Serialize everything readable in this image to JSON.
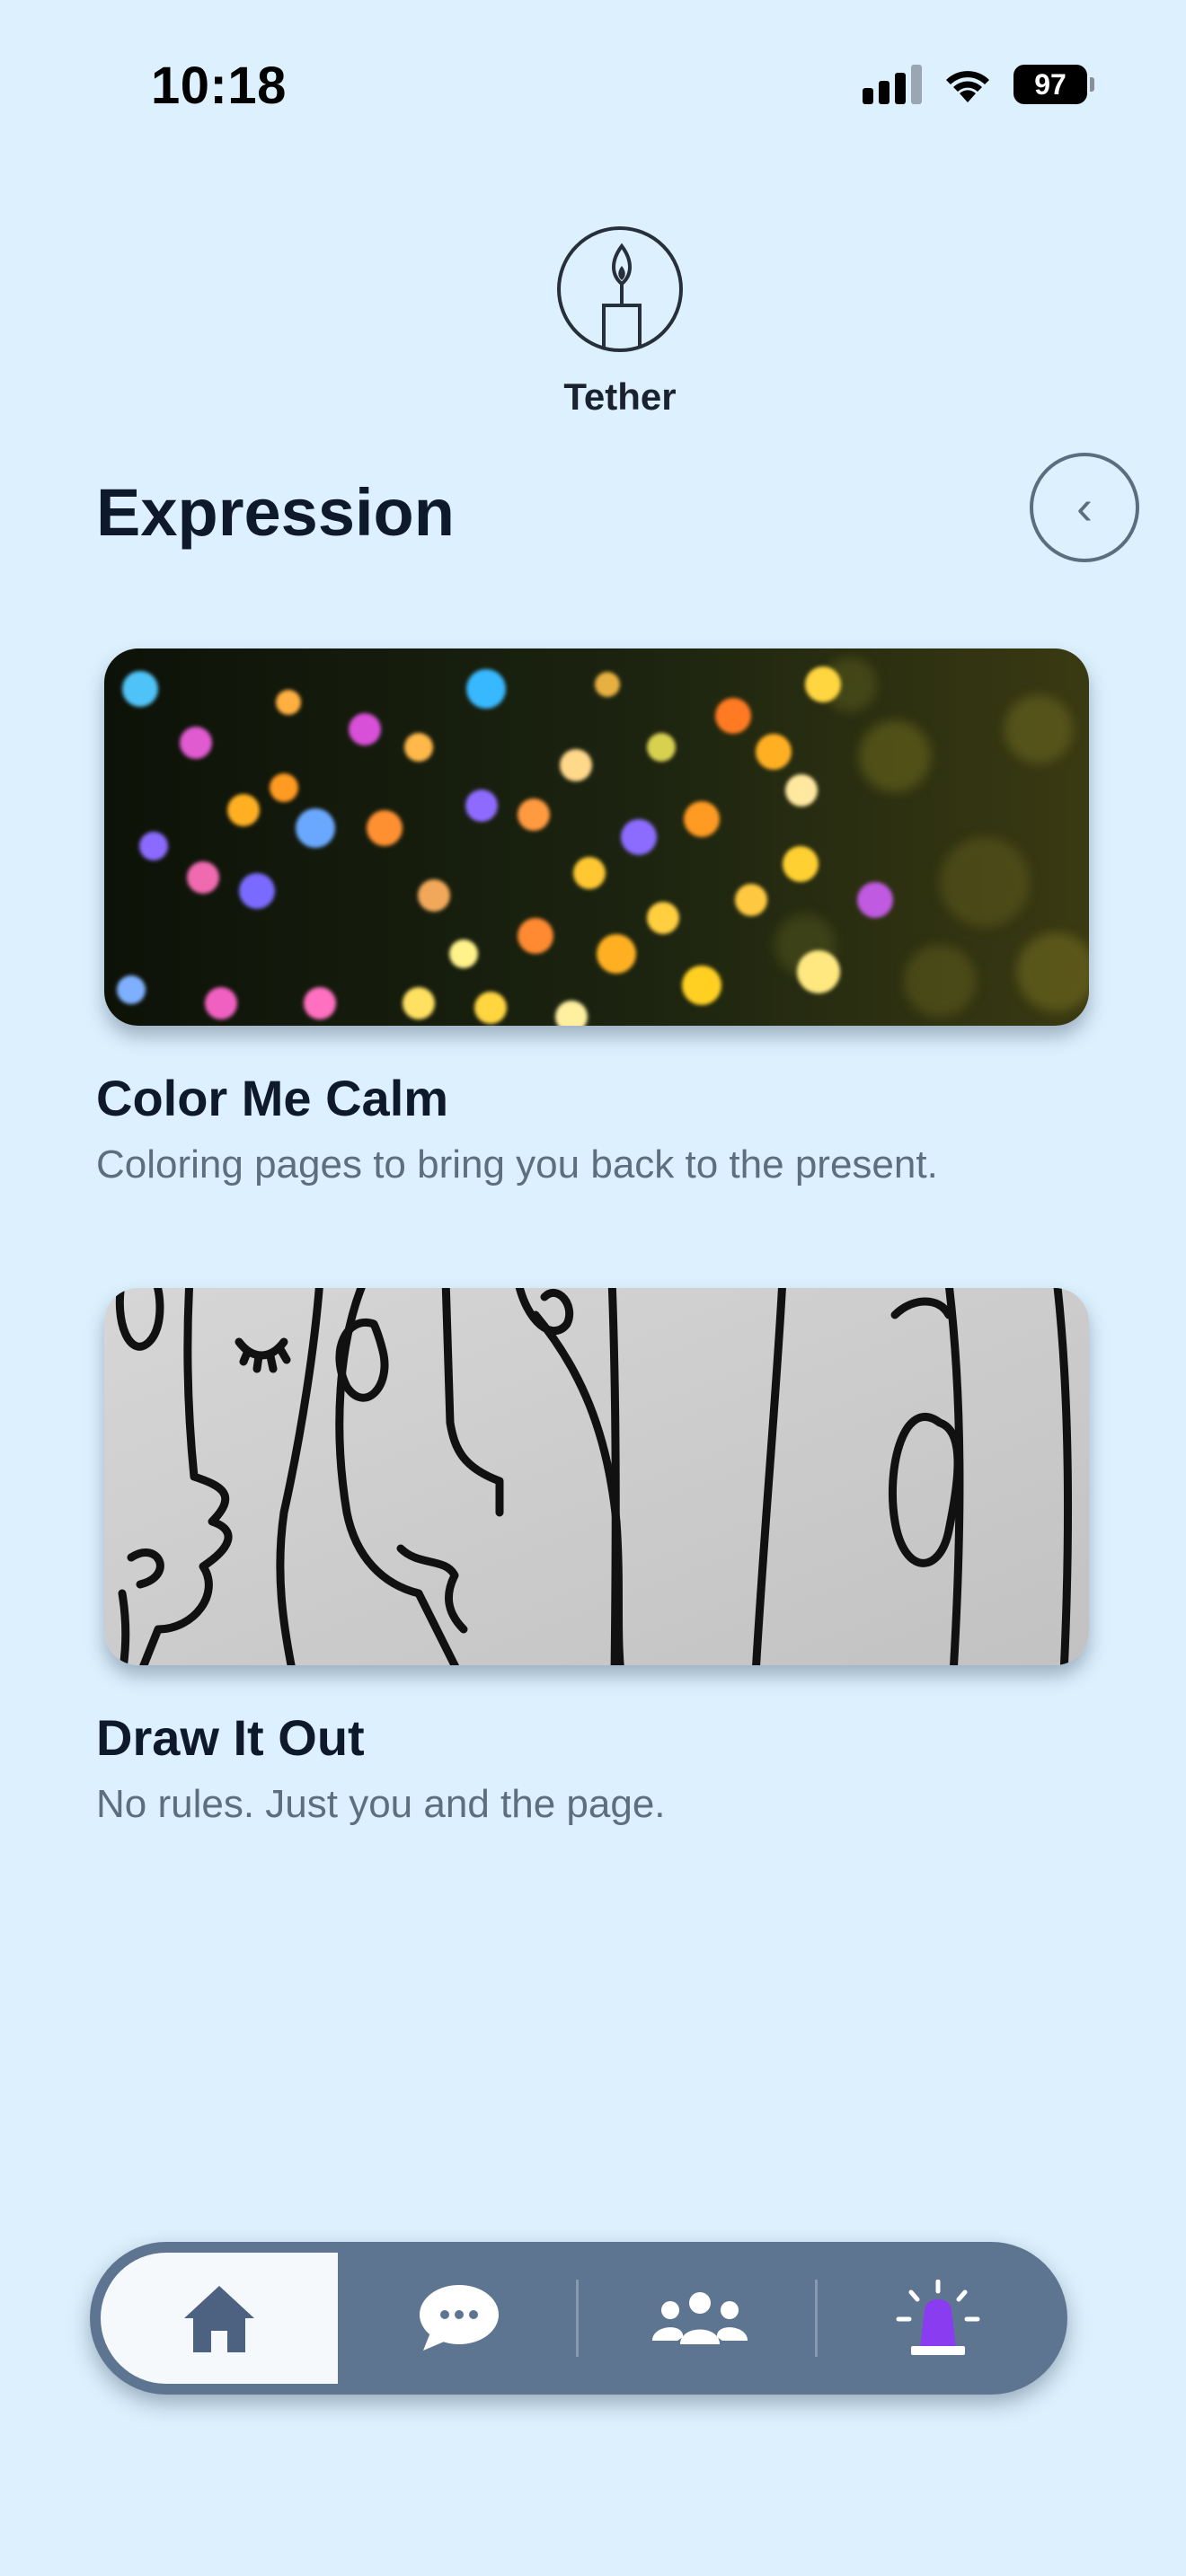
{
  "status_bar": {
    "time": "10:18",
    "battery": "97",
    "icons": [
      "signal-icon",
      "wifi-icon",
      "battery-icon"
    ]
  },
  "app": {
    "logo_text": "Tether",
    "logo_icon": "candle-icon"
  },
  "header": {
    "title": "Expression",
    "back_icon": "chevron-left-icon",
    "back_glyph": "‹"
  },
  "cards": [
    {
      "title": "Color Me Calm",
      "description": "Coloring pages to bring you back to the present.",
      "image": "bokeh-lights-photo"
    },
    {
      "title": "Draw It Out",
      "description": "No rules. Just you and the page.",
      "image": "line-art-faces-drawing"
    }
  ],
  "bottom_nav": {
    "items": [
      {
        "icon": "home-icon",
        "active": true
      },
      {
        "icon": "chat-icon",
        "active": false
      },
      {
        "icon": "community-icon",
        "active": false
      },
      {
        "icon": "alert-siren-icon",
        "active": false
      }
    ]
  },
  "colors": {
    "background": "#dcf0fd",
    "nav_bar": "#5e7592",
    "active_tab": "#f6f9fc",
    "title": "#0e1a2c",
    "muted_text": "#5d6e7f",
    "siren_accent": "#8a3cf0"
  }
}
